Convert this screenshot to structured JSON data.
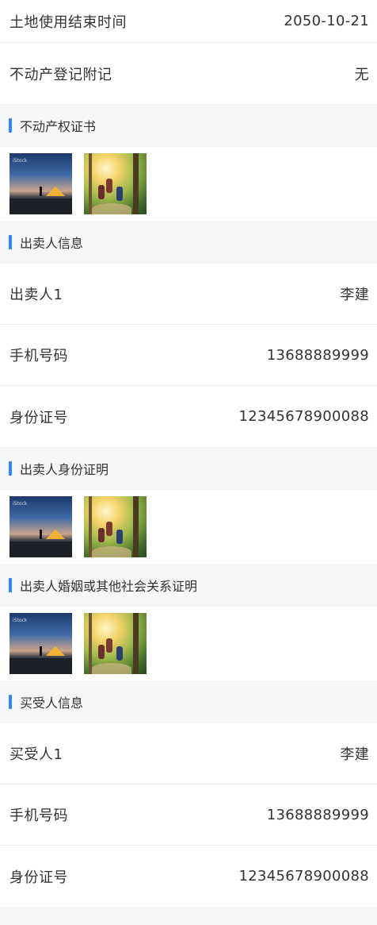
{
  "land_info": {
    "end_time_label": "土地使用结束时间",
    "end_time_value": "2050-10-21",
    "register_note_label": "不动产登记附记",
    "register_note_value": "无"
  },
  "sections": {
    "property_cert": "不动产权证书",
    "seller_info": "出卖人信息",
    "seller_id_proof": "出卖人身份证明",
    "seller_marriage_proof": "出卖人婚姻或其他社会关系证明",
    "buyer_info": "买受人信息"
  },
  "seller": {
    "name_label": "出卖人1",
    "name_value": "李建",
    "phone_label": "手机号码",
    "phone_value": "13688889999",
    "id_label": "身份证号",
    "id_value": "12345678900088"
  },
  "buyer": {
    "name_label": "买受人1",
    "name_value": "李建",
    "phone_label": "手机号码",
    "phone_value": "13688889999",
    "id_label": "身份证号",
    "id_value": "12345678900088"
  },
  "image_watermark": "iStock",
  "colors": {
    "accent": "#2f86f6",
    "background": "#f5f6f8",
    "card": "#ffffff"
  }
}
